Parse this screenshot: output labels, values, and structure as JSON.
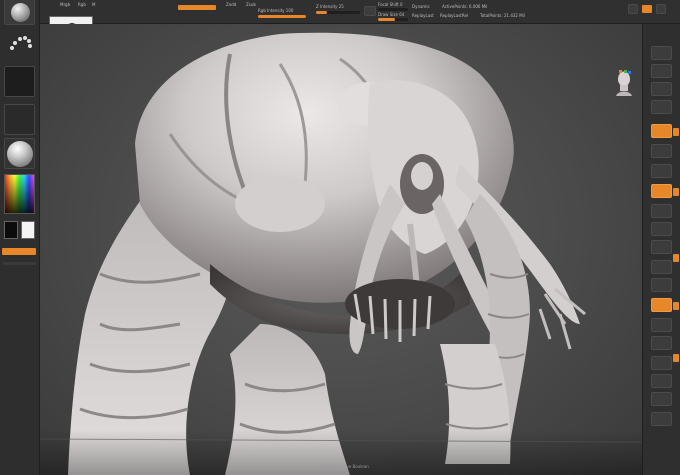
{
  "app": {
    "name": ""
  },
  "top_bar": {
    "labels": {
      "mrgb": "Mrgb",
      "rgb": "Rgb",
      "m": "M",
      "zadd": "Zadd",
      "zsub": "Zsub",
      "focal_shift": "Focal Shift 0",
      "draw_size": "Draw Size 64",
      "dynamic": "Dynamic",
      "z_intensity": "Z Intensity 25",
      "active_points": "ActivePoints: 6.006 Mil",
      "total_points": "TotalPoints: 21.432 Mil",
      "rgb_intensity": "Rgb Intensity 100",
      "replay_last": "ReplayLast",
      "replay_last_rel": "ReplayLastRel"
    },
    "sliders": {
      "focal_shift": 0.0,
      "draw_size": 0.55,
      "z_intensity": 0.25,
      "rgb_intensity": 1.0
    }
  },
  "status_bar": {
    "footer_text": "Lightbox  >  Live Boolean"
  },
  "colors": {
    "accent": "#e8862a",
    "panel": "#2e2e2e",
    "canvas": "#4a4a4a",
    "model": "#d8d4d4"
  },
  "icons": {
    "brush": "standard-brush-icon",
    "stroke": "dots-stroke-icon",
    "alpha": "alpha-icon",
    "texture": "texture-icon",
    "material": "matcap-sphere-icon",
    "color": "color-picker-icon",
    "navigator": "head-navigator-icon"
  }
}
